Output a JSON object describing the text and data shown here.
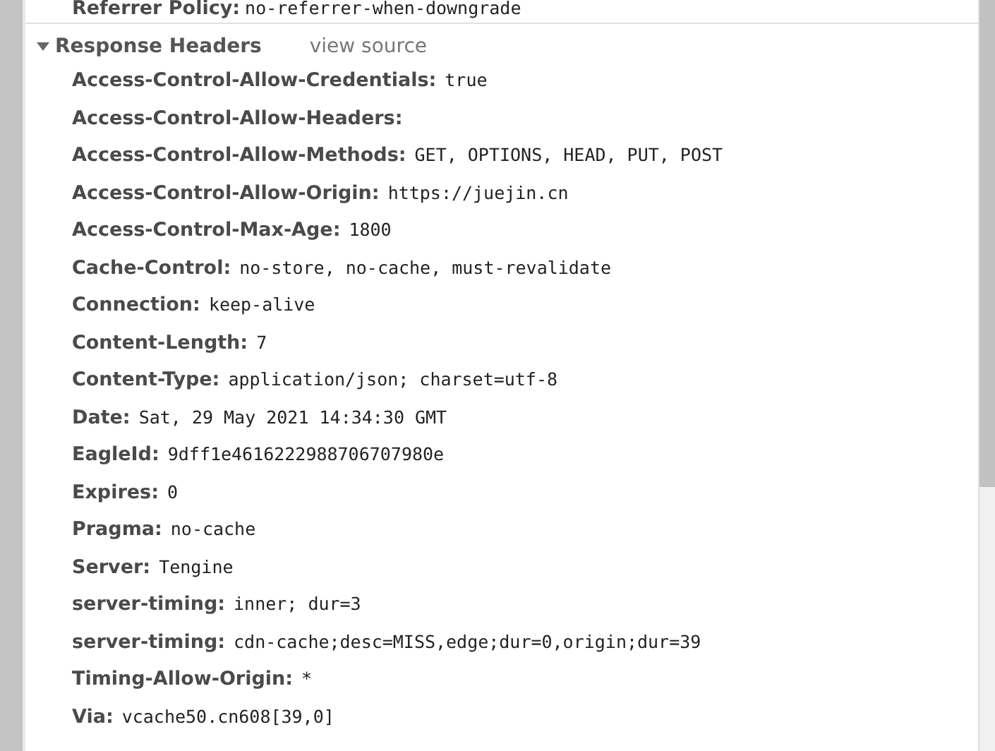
{
  "previous_row": {
    "name": "Referrer Policy:",
    "value": "no-referrer-when-downgrade"
  },
  "section": {
    "title": "Response Headers",
    "expanded": true,
    "link": "view source"
  },
  "headers": [
    {
      "name": "Access-Control-Allow-Credentials:",
      "value": "true"
    },
    {
      "name": "Access-Control-Allow-Headers:"
    },
    {
      "name": "Access-Control-Allow-Methods:",
      "value": "GET, OPTIONS, HEAD, PUT, POST"
    },
    {
      "name": "Access-Control-Allow-Origin:",
      "value": "https://juejin.cn"
    },
    {
      "name": "Access-Control-Max-Age:",
      "value": "1800"
    },
    {
      "name": "Cache-Control:",
      "value": "no-store, no-cache, must-revalidate"
    },
    {
      "name": "Connection:",
      "value": "keep-alive"
    },
    {
      "name": "Content-Length:",
      "value": "7"
    },
    {
      "name": "Content-Type:",
      "value": "application/json; charset=utf-8"
    },
    {
      "name": "Date:",
      "value": "Sat, 29 May 2021 14:34:30 GMT"
    },
    {
      "name": "EagleId:",
      "value": "9dff1e4616222988706707980e"
    },
    {
      "name": "Expires:",
      "value": "0"
    },
    {
      "name": "Pragma:",
      "value": "no-cache"
    },
    {
      "name": "Server:",
      "value": "Tengine"
    },
    {
      "name": "server-timing:",
      "value": "inner; dur=3"
    },
    {
      "name": "server-timing:",
      "value": "cdn-cache;desc=MISS,edge;dur=0,origin;dur=39"
    },
    {
      "name": "Timing-Allow-Origin:",
      "value": "*"
    },
    {
      "name": "Via:",
      "value": "vcache50.cn608[39,0]"
    }
  ]
}
